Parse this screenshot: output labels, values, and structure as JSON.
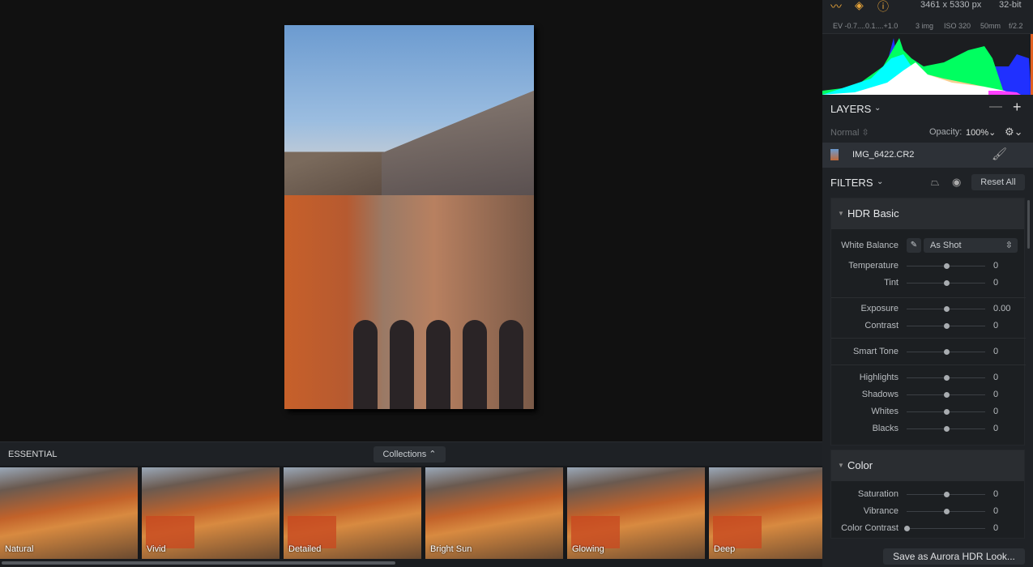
{
  "image_info": {
    "dimensions": "3461 x 5330 px",
    "bit_depth": "32-bit",
    "ev": "EV  -0.7....0.1....+1.0",
    "images": "3 img",
    "iso": "ISO 320",
    "focal": "50mm",
    "aperture": "f/2.2"
  },
  "toolbar_icons": [
    "histogram-icon",
    "layers-icon",
    "info-icon"
  ],
  "layers": {
    "title": "LAYERS",
    "blend_mode": "Normal",
    "opacity_label": "Opacity:",
    "opacity_value": "100%",
    "layer_name": "IMG_6422.CR2"
  },
  "filters": {
    "title": "FILTERS",
    "reset_label": "Reset All"
  },
  "hdr_basic": {
    "title": "HDR Basic",
    "white_balance_label": "White Balance",
    "white_balance_value": "As Shot",
    "sliders": [
      {
        "label": "Temperature",
        "value": "0",
        "pos": 0.5
      },
      {
        "label": "Tint",
        "value": "0",
        "pos": 0.5
      },
      {
        "label": "Exposure",
        "value": "0.00",
        "pos": 0.5
      },
      {
        "label": "Contrast",
        "value": "0",
        "pos": 0.5
      },
      {
        "label": "Smart Tone",
        "value": "0",
        "pos": 0.5
      },
      {
        "label": "Highlights",
        "value": "0",
        "pos": 0.5
      },
      {
        "label": "Shadows",
        "value": "0",
        "pos": 0.5
      },
      {
        "label": "Whites",
        "value": "0",
        "pos": 0.5
      },
      {
        "label": "Blacks",
        "value": "0",
        "pos": 0.5
      }
    ]
  },
  "color": {
    "title": "Color",
    "sliders": [
      {
        "label": "Saturation",
        "value": "0",
        "pos": 0.5
      },
      {
        "label": "Vibrance",
        "value": "0",
        "pos": 0.5
      },
      {
        "label": "Color Contrast",
        "value": "0",
        "pos": 0
      }
    ]
  },
  "save_look_label": "Save as Aurora HDR Look...",
  "strip": {
    "title": "ESSENTIAL",
    "collections_label": "Collections ⌃",
    "presets": [
      "Natural",
      "Vivid",
      "Detailed",
      "Bright Sun",
      "Glowing",
      "Deep"
    ]
  },
  "colors": {
    "accent": "#e8a53a",
    "panel": "#1f2226"
  }
}
